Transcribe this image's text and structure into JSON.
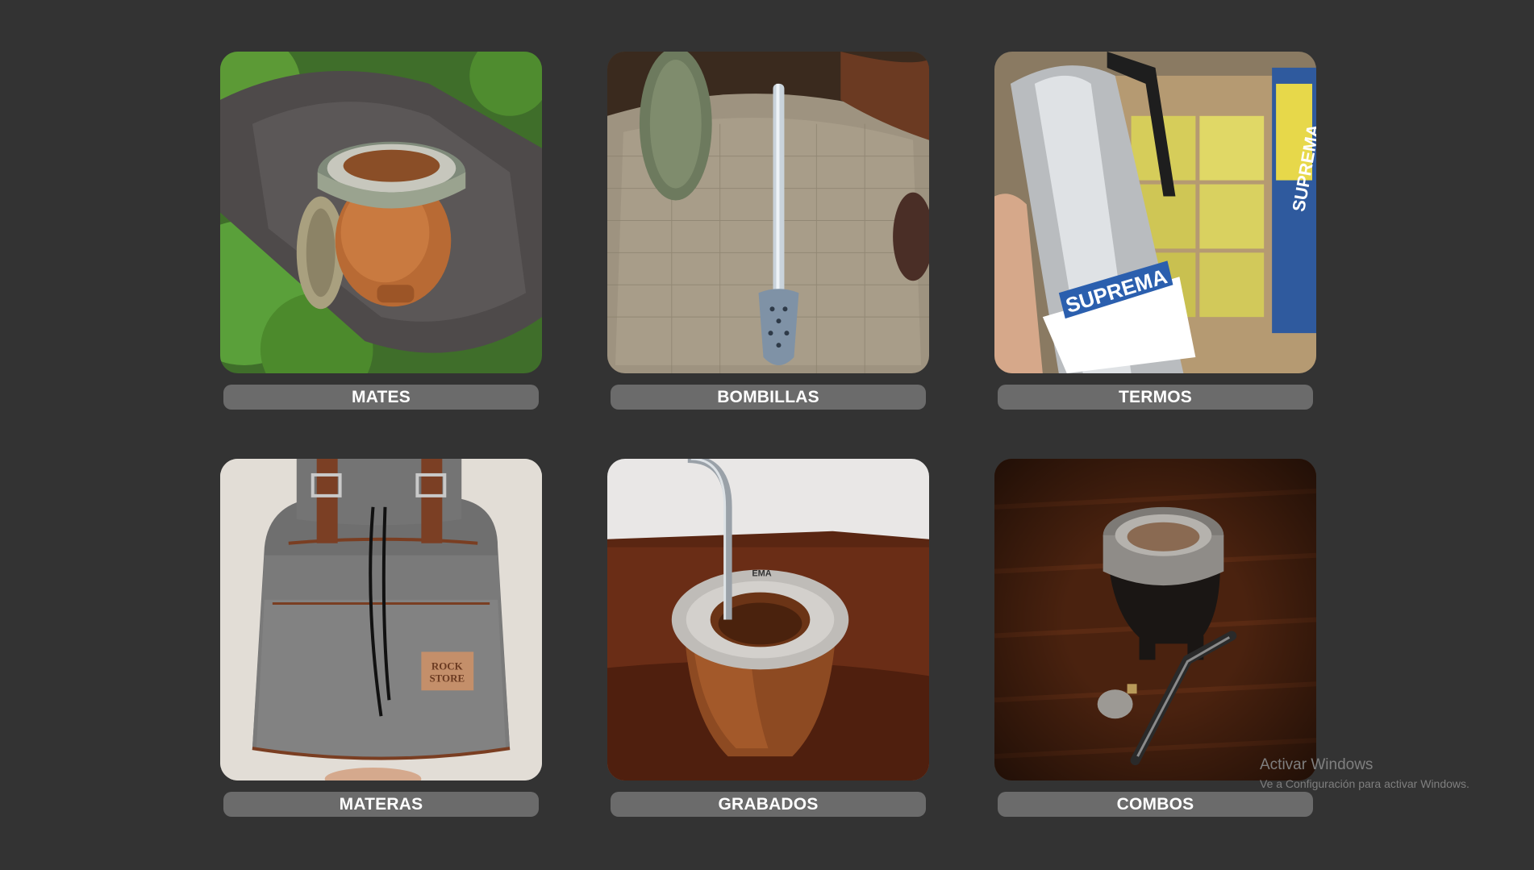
{
  "categories": [
    {
      "label": "MATES",
      "image": "mate-gourd-on-rock-photo"
    },
    {
      "label": "BOMBILLAS",
      "image": "bombilla-on-burlap-photo"
    },
    {
      "label": "TERMOS",
      "image": "suprema-thermos-photo"
    },
    {
      "label": "MATERAS",
      "image": "rock-store-backpack-photo"
    },
    {
      "label": "GRABADOS",
      "image": "engraved-mate-photo"
    },
    {
      "label": "COMBOS",
      "image": "mate-combo-on-wood-photo"
    }
  ],
  "photo_text": {
    "termos_brand": "SUPREMA",
    "materas_patch_line1": "ROCK",
    "materas_patch_line2": "STORE",
    "grabados_ring": "EMA"
  },
  "watermark": {
    "title": "Activar Windows",
    "subtitle": "Ve a Configuración para activar Windows."
  },
  "colors": {
    "background": "#333333",
    "label_bg": "#6b6b6b",
    "label_text": "#ffffff"
  }
}
